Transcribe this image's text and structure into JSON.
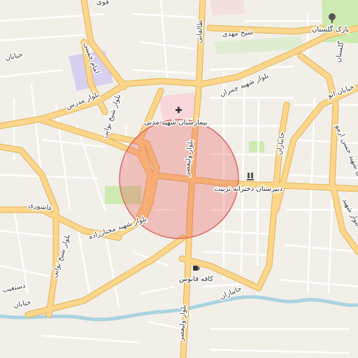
{
  "map": {
    "labels": {
      "top_left_fragment": "قوی",
      "park": "پارک گلستان",
      "sheikh_mahdi": "شیخ مهدی",
      "taleghani": "طالقانی",
      "imam_khomeini": "امام خمینی",
      "khiaban_left": "خیابان",
      "modares": "بلوار مدرس",
      "shahid_chamran": "بلوار شهید چمران",
      "hospital": "بیمارستان شهید مدنی",
      "sheikh_nawai": "بلوار شیخ نوایی",
      "valiasr_top": "بلوار ولیعصر",
      "school": "دبیرستان دخترانه تربیت",
      "jahanbaran_right": "جانبازان",
      "ashouri": "عاشوری",
      "mokhtarzadeh": "بلوار شهید مختارزاده",
      "sheikh_nawai_low": "بلوار شیخ نوایی",
      "cafe": "کافه فانوس",
      "jahanbaran_low": "جانبازان",
      "dastgheib": "دستغیب",
      "khiaban_low": "خیابان",
      "valiasr_low": "بلوار ولیعصر",
      "hasan_armoo": "خیابان شهید حسن ارمو",
      "right_edge": "گلستان",
      "blvd_right": "بلوار شهید...",
      "khiaban_abu": "خیابان ابو"
    },
    "icons": {
      "hospital": "hospital-cross-icon",
      "school": "school-icon",
      "cafe": "coffee-cup-icon",
      "park": "tree-icon"
    },
    "colors": {
      "background": "#f2efe9",
      "major_road": "#fcd68a",
      "major_road_casing": "#e2b35a",
      "minor_road": "#ffffff",
      "river": "#aad3df",
      "park_fill": "#cdebb0",
      "hospital_fill": "#f8d7dc",
      "institution_fill": "#d9d0f0",
      "highlight_circle_fill": "rgba(230,70,70,0.28)",
      "highlight_circle_stroke": "#e06666"
    }
  }
}
